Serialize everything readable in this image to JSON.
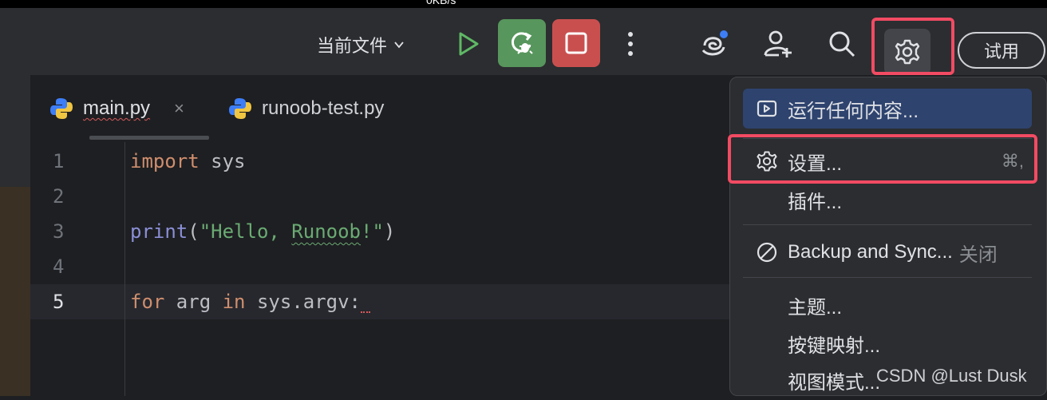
{
  "menubar": {
    "network_rate": "0KB/s"
  },
  "toolbar": {
    "run_config": "当前文件",
    "try_label": "试用"
  },
  "tabs": [
    {
      "label": "main.py",
      "active": true,
      "close": "×"
    },
    {
      "label": "runoob-test.py",
      "active": false
    }
  ],
  "editor": {
    "lines": [
      {
        "number": "1",
        "tokens": [
          {
            "t": "import",
            "c": "kw"
          },
          {
            "t": " sys",
            "c": "plain"
          }
        ]
      },
      {
        "number": "2",
        "tokens": []
      },
      {
        "number": "3",
        "tokens": [
          {
            "t": "print",
            "c": "fn"
          },
          {
            "t": "(",
            "c": "plain"
          },
          {
            "t": "\"Hello, ",
            "c": "str"
          },
          {
            "t": "Runoob",
            "c": "str wavy-green"
          },
          {
            "t": "!\"",
            "c": "str"
          },
          {
            "t": ")",
            "c": "plain"
          }
        ]
      },
      {
        "number": "4",
        "tokens": []
      },
      {
        "number": "5",
        "tokens": [
          {
            "t": "for",
            "c": "kw"
          },
          {
            "t": " arg ",
            "c": "plain"
          },
          {
            "t": "in",
            "c": "kw"
          },
          {
            "t": " sys.argv:",
            "c": "plain"
          }
        ],
        "current": true
      }
    ]
  },
  "menu": {
    "run_anything": "运行任何内容...",
    "settings": "设置...",
    "settings_shortcut": "⌘,",
    "plugins": "插件...",
    "backup_sync": "Backup and Sync...",
    "backup_sync_state": "关闭",
    "theme": "主题...",
    "keymap": "按键映射...",
    "view_mode": "视图模式..."
  },
  "watermark": "CSDN @Lust Dusk",
  "colors": {
    "accent_highlight": "#f24b63",
    "debug_green": "#57965c",
    "stop_red": "#c94f4f",
    "menu_selected": "#2e436e"
  }
}
